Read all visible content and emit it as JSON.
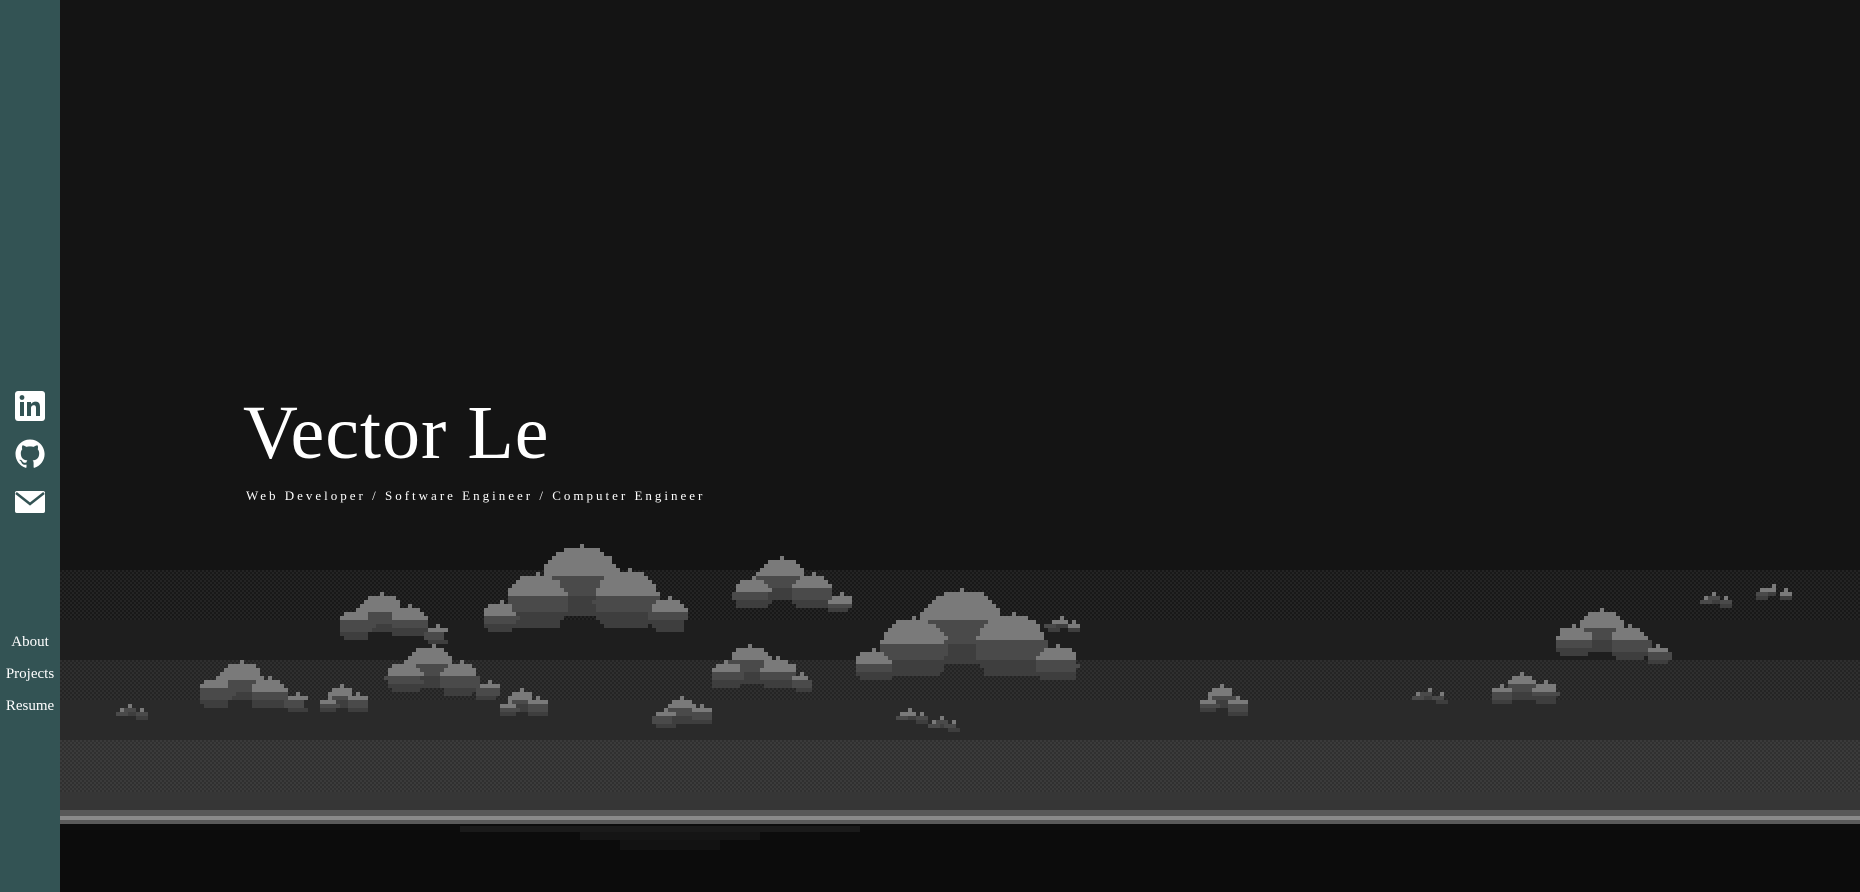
{
  "sidebar": {
    "social": [
      {
        "icon": "linkedin-icon",
        "label": "LinkedIn"
      },
      {
        "icon": "github-icon",
        "label": "GitHub"
      },
      {
        "icon": "mail-icon",
        "label": "Email"
      }
    ],
    "nav": [
      {
        "label": "About"
      },
      {
        "label": "Projects"
      },
      {
        "label": "Resume"
      }
    ]
  },
  "hero": {
    "title": "Vector Le",
    "subtitle": "Web Developer / Software Engineer / Computer Engineer"
  },
  "colors": {
    "sidebar": "#335354",
    "background": "#141414",
    "text": "#ffffff",
    "cloud_dark": "#4a4a4a",
    "cloud_light": "#7a7a7a"
  }
}
